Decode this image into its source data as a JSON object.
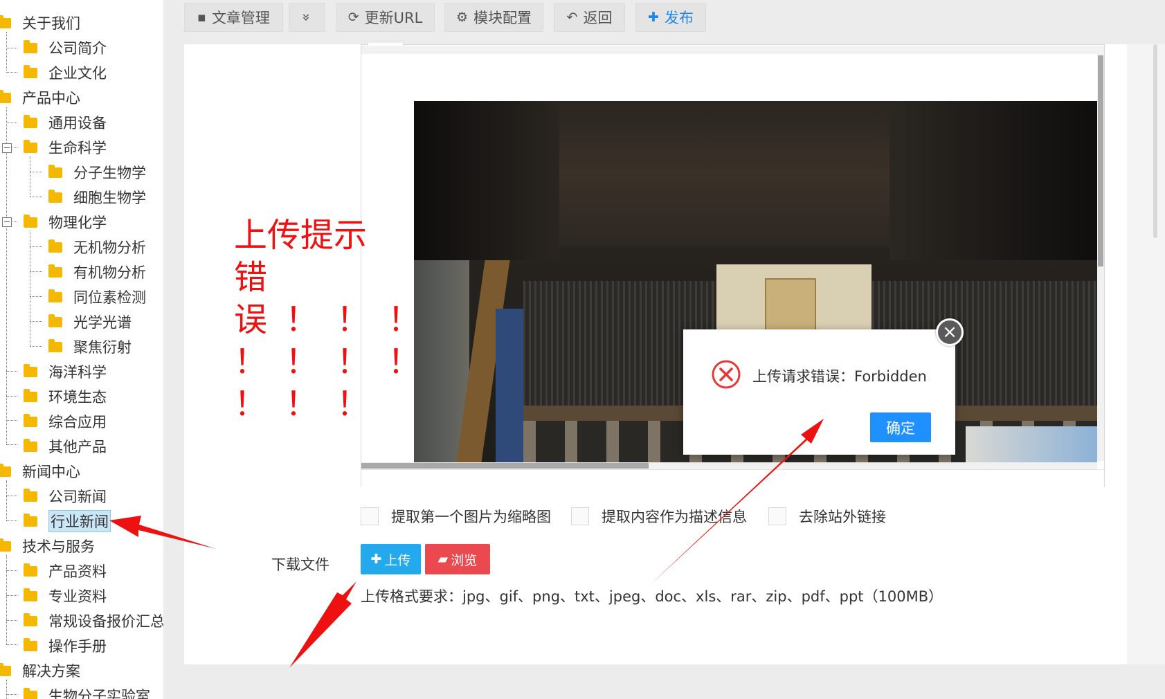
{
  "tree": {
    "about": "关于我们",
    "about_intro": "公司简介",
    "about_culture": "企业文化",
    "products": "产品中心",
    "general_equipment": "通用设备",
    "life_science": "生命科学",
    "molecular_biology": "分子生物学",
    "cell_biology": "细胞生物学",
    "physical_chemistry": "物理化学",
    "inorganic_analysis": "无机物分析",
    "organic_analysis": "有机物分析",
    "isotope_detection": "同位素检测",
    "optical_spectra": "光学光谱",
    "focused_diffraction": "聚焦衍射",
    "marine_science": "海洋科学",
    "environment_ecology": "环境生态",
    "integrated_application": "综合应用",
    "other_products": "其他产品",
    "news": "新闻中心",
    "company_news": "公司新闻",
    "industry_news": "行业新闻",
    "tech_service": "技术与服务",
    "product_docs": "产品资料",
    "professional_docs": "专业资料",
    "equipment_quotes": "常规设备报价汇总",
    "manuals": "操作手册",
    "solutions": "解决方案",
    "bio_lab": "生物分子实验室"
  },
  "toolbar": {
    "article_manage": "文章管理",
    "more": "»",
    "update_url": "更新URL",
    "module_config": "模块配置",
    "back": "返回",
    "publish": "发布"
  },
  "annotation": {
    "line1": "上传提示",
    "line2": "错",
    "line3": "误！！！",
    "line4": "！！！！",
    "line5": "！！！"
  },
  "options": {
    "thumb_first_image": "提取第一个图片为缩略图",
    "extract_description": "提取内容作为描述信息",
    "remove_external_links": "去除站外链接"
  },
  "download": {
    "label": "下载文件",
    "upload_button": "上传",
    "browse_button": "浏览",
    "format_hint": "上传格式要求：jpg、gif、png、txt、jpeg、doc、xls、rar、zip、pdf、ppt（100MB）"
  },
  "dialog": {
    "message": "上传请求错误：Forbidden",
    "ok_button": "确定",
    "close_symbol": "×"
  },
  "icons": {
    "article": "square-icon",
    "more": "chevron-double-down-icon",
    "refresh": "refresh-icon",
    "gear": "gear-icon",
    "back": "undo-icon",
    "plus": "plus-icon",
    "folder": "folder-icon",
    "error": "error-circle-icon"
  },
  "colors": {
    "folder": "#f5b800",
    "annotation_red": "#ee1111",
    "publish_blue": "#1e88e5",
    "upload_blue": "#24a9ec",
    "browse_red": "#ea4a4f",
    "ok_blue": "#1e90ff"
  }
}
